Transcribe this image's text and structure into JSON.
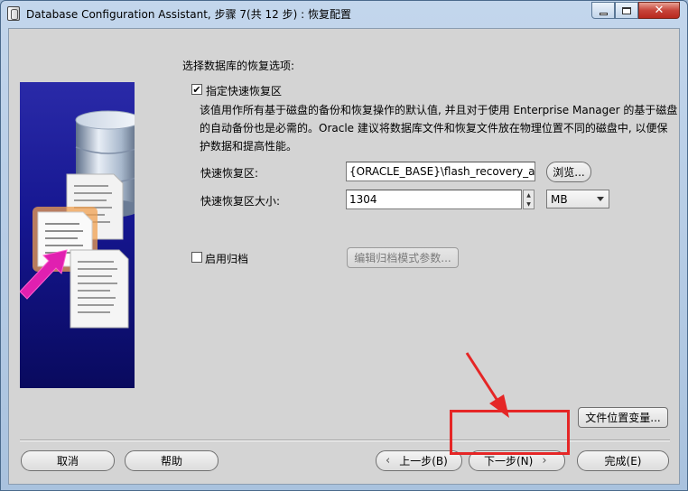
{
  "window": {
    "title": "Database Configuration Assistant, 步骤 7(共 12 步) : 恢复配置",
    "icon": "dbca-app-icon",
    "controls": {
      "minimize": "minimize-icon",
      "maximize": "maximize-icon",
      "close": "✕"
    }
  },
  "recovery": {
    "section_label": "选择数据库的恢复选项:",
    "flash_checkbox": {
      "label": "指定快速恢复区",
      "checked": true,
      "mark": "✔"
    },
    "description": "该值用作所有基于磁盘的备份和恢复操作的默认值, 并且对于使用 Enterprise Manager 的基于磁盘的自动备份也是必需的。Oracle 建议将数据库文件和恢复文件放在物理位置不同的磁盘中, 以便保护数据和提高性能。",
    "area_label": "快速恢复区:",
    "area_value": "{ORACLE_BASE}\\flash_recovery_area",
    "browse_button": "浏览...",
    "size_label": "快速恢复区大小:",
    "size_value": "1304",
    "unit_value": "MB",
    "archive_checkbox": {
      "label": "启用归档",
      "checked": false
    },
    "archive_params_button": "编辑归档模式参数..."
  },
  "footer": {
    "file_location_button": "文件位置变量...",
    "cancel_button": "取消",
    "help_button": "帮助",
    "back_button": "上一步(B)",
    "next_button": "下一步(N)",
    "finish_button": "完成(E)",
    "back_icon": "‹",
    "next_icon": "›"
  },
  "colors": {
    "annotation": "#e52626",
    "art_background": "#151690"
  }
}
